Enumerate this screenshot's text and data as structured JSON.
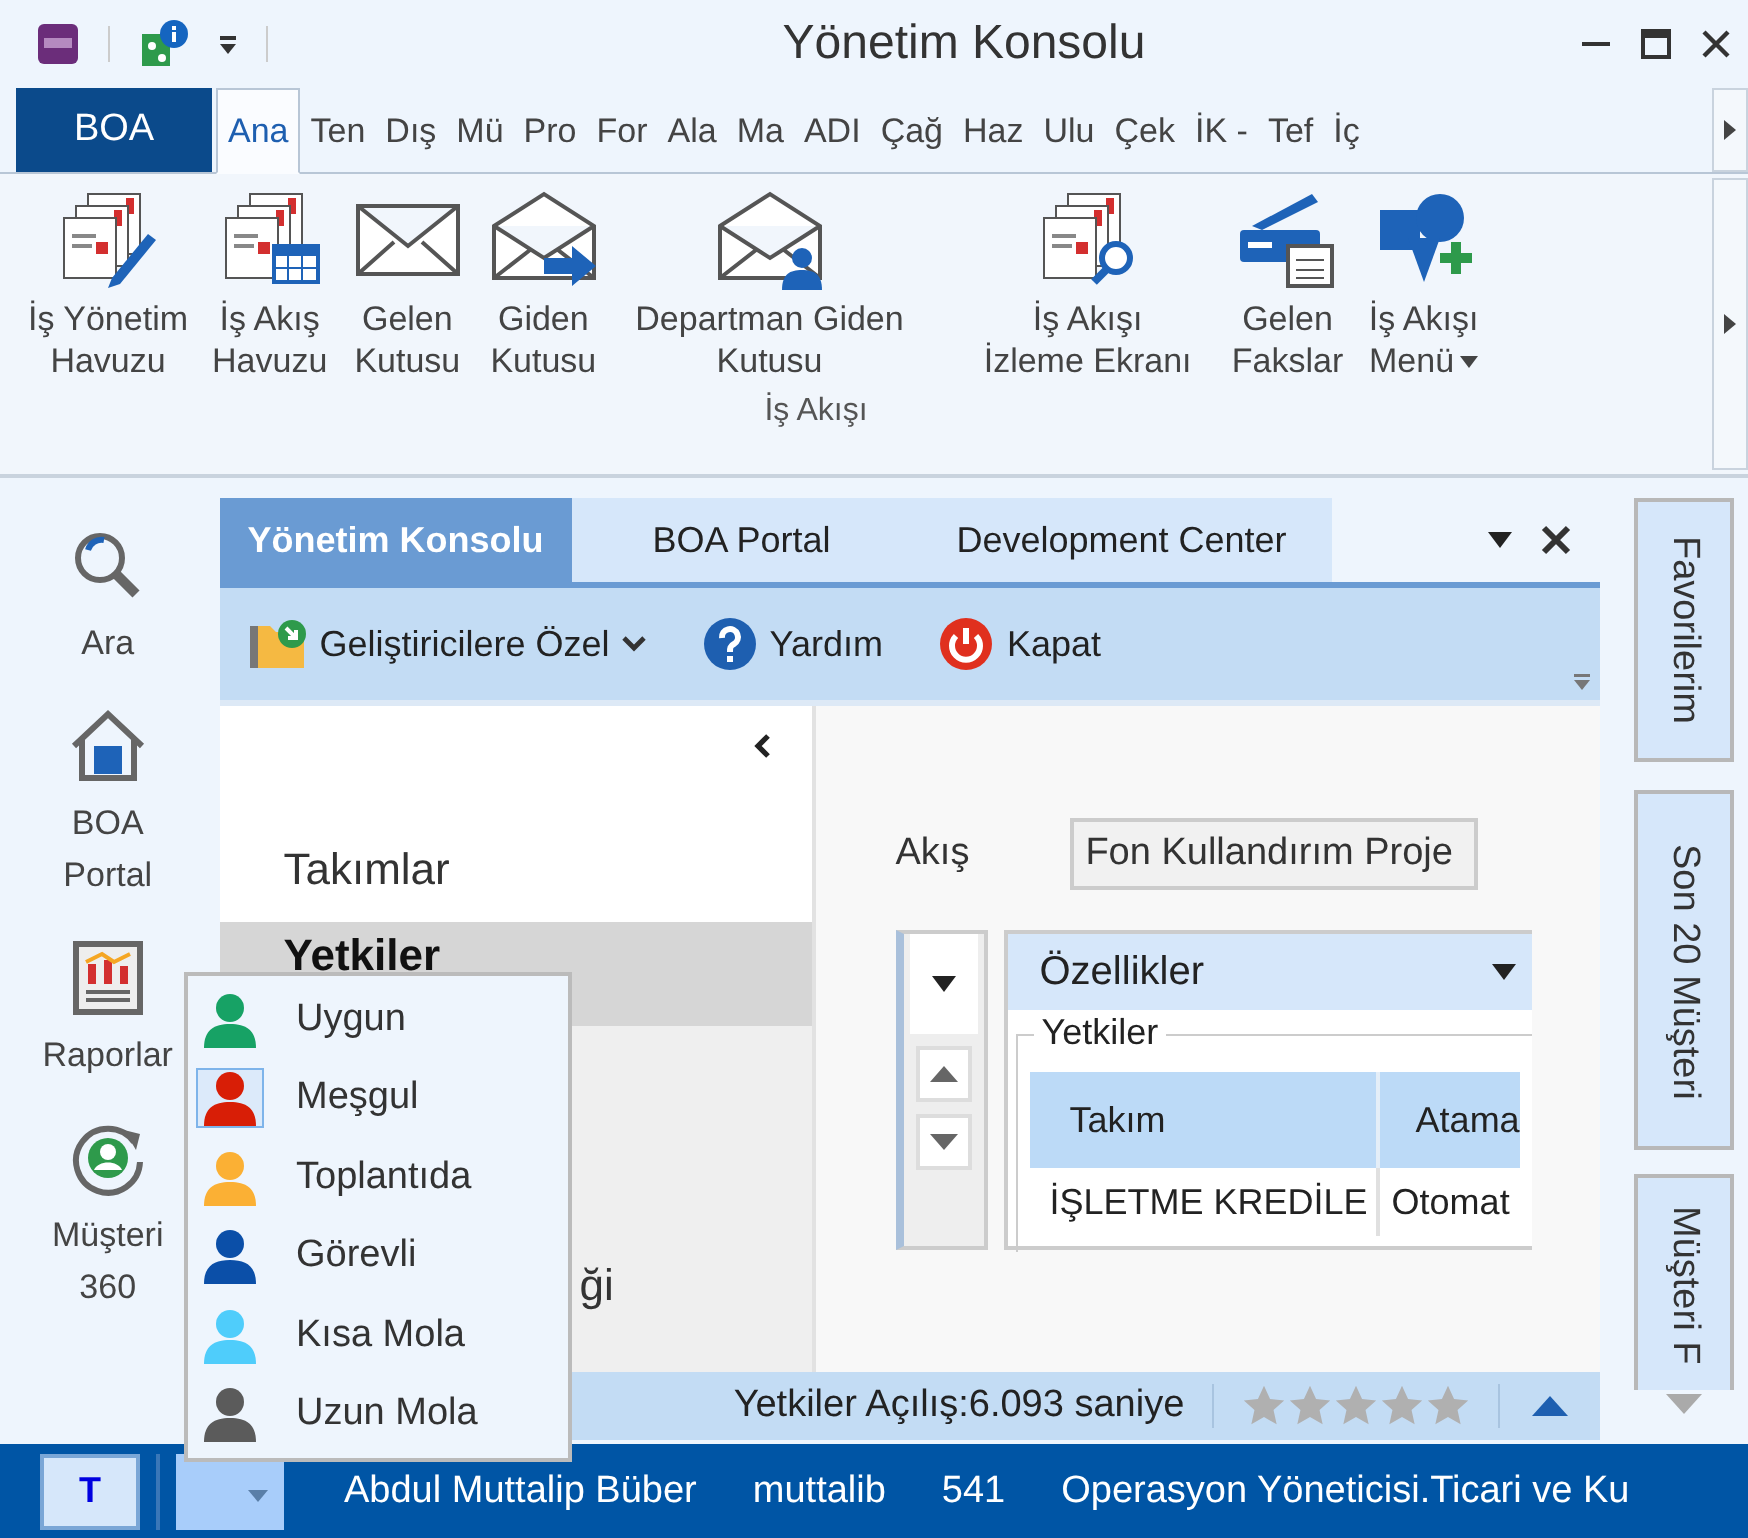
{
  "window": {
    "title": "Yönetim Konsolu"
  },
  "ribbon": {
    "app_button": "BOA",
    "tabs": [
      {
        "label": "Ana",
        "selected": true
      },
      {
        "label": "Ten",
        "selected": false
      },
      {
        "label": "Dış",
        "selected": false
      },
      {
        "label": "Mü",
        "selected": false
      },
      {
        "label": "Pro",
        "selected": false
      },
      {
        "label": "For",
        "selected": false
      },
      {
        "label": "Ala",
        "selected": false
      },
      {
        "label": "Ma",
        "selected": false
      },
      {
        "label": "ADI",
        "selected": false
      },
      {
        "label": "Çağ",
        "selected": false
      },
      {
        "label": "Haz",
        "selected": false
      },
      {
        "label": "Ulu",
        "selected": false
      },
      {
        "label": "Çek",
        "selected": false
      },
      {
        "label": "İK -",
        "selected": false
      },
      {
        "label": "Tef",
        "selected": false
      },
      {
        "label": "İç",
        "selected": false
      }
    ],
    "group": {
      "label": "İş Akışı",
      "buttons": [
        {
          "lines": [
            "İş Yönetim",
            "Havuzu"
          ],
          "kind": "docs-pen",
          "has_menu": false
        },
        {
          "lines": [
            "İş Akış",
            "Havuzu"
          ],
          "kind": "docs-grid",
          "has_menu": false
        },
        {
          "lines": [
            "Gelen",
            "Kutusu"
          ],
          "kind": "envelope",
          "has_menu": false
        },
        {
          "lines": [
            "Giden",
            "Kutusu"
          ],
          "kind": "envelope-out",
          "has_menu": false
        },
        {
          "lines": [
            "Departman Giden",
            "Kutusu"
          ],
          "kind": "envelope-user",
          "has_menu": false
        },
        {
          "lines": [
            "İş Akışı",
            "İzleme Ekranı"
          ],
          "kind": "docs-search",
          "has_menu": false
        },
        {
          "lines": [
            "Gelen",
            "Fakslar"
          ],
          "kind": "scanner",
          "has_menu": false
        },
        {
          "lines": [
            "İş Akışı",
            "Menü"
          ],
          "kind": "shapes",
          "has_menu": true
        }
      ]
    }
  },
  "sidebar": {
    "items": [
      {
        "lines": [
          "Ara"
        ],
        "kind": "search"
      },
      {
        "lines": [
          "BOA",
          "Portal"
        ],
        "kind": "home"
      },
      {
        "lines": [
          "Raporlar"
        ],
        "kind": "report"
      },
      {
        "lines": [
          "Müşteri",
          "360"
        ],
        "kind": "customer"
      }
    ]
  },
  "document_tabs": [
    {
      "label": "Yönetim Konsolu",
      "selected": true
    },
    {
      "label": "BOA Portal",
      "selected": false
    },
    {
      "label": "Development Center",
      "selected": false
    }
  ],
  "toolbar": [
    {
      "label": "Geliştiricilere Özel",
      "kind": "folder",
      "has_menu": true
    },
    {
      "label": "Yardım",
      "kind": "help",
      "has_menu": false
    },
    {
      "label": "Kapat",
      "kind": "power",
      "has_menu": false
    }
  ],
  "navigation": [
    {
      "label": "Takımlar",
      "selected": false
    },
    {
      "label": "Yetkiler",
      "selected": true
    },
    {
      "label": "ği",
      "selected": false
    }
  ],
  "form": {
    "flow_label": "Akış",
    "flow_value": "Fon Kullandırım Proje",
    "properties": "Özellikler",
    "group_title": "Yetkiler",
    "table": {
      "columns": [
        "Takım",
        "Atama"
      ],
      "rows": [
        [
          "İŞLETME KREDİLE",
          "Otomat"
        ]
      ]
    }
  },
  "status": {
    "text": "Yetkiler Açılış:6.093 saniye",
    "stars": 0
  },
  "right_tabs": [
    "Favorilerim",
    "Son 20 Müşteri",
    "Müşteri F"
  ],
  "status_menu": [
    {
      "label": "Uygun",
      "color": "#17a265",
      "selected": false
    },
    {
      "label": "Meşgul",
      "color": "#d81e06",
      "selected": true
    },
    {
      "label": "Toplantıda",
      "color": "#fbb034",
      "selected": false
    },
    {
      "label": "Görevli",
      "color": "#0b4fa8",
      "selected": false
    },
    {
      "label": "Kısa Mola",
      "color": "#4fcdfb",
      "selected": false
    },
    {
      "label": "Uzun Mola",
      "color": "#5b5b5b",
      "selected": false
    }
  ],
  "bottom_bar": {
    "badge": "T",
    "fields": [
      "Abdul Muttalip Büber",
      "muttalib",
      "541",
      "Operasyon Yöneticisi.Ticari ve Ku"
    ]
  }
}
